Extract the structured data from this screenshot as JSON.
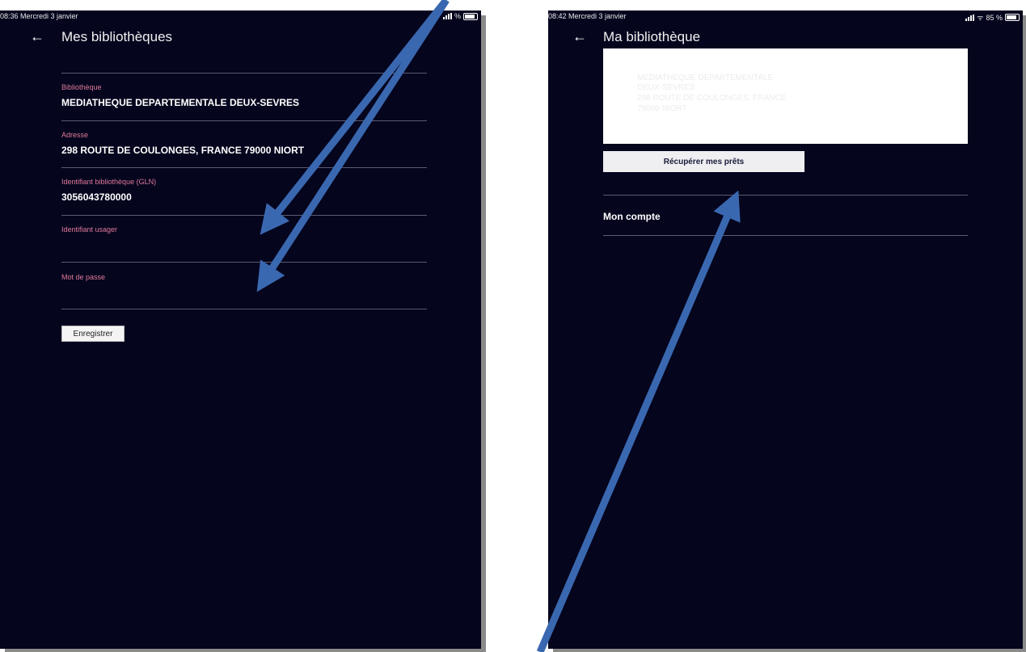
{
  "left": {
    "status_time": "08:36  Mercredi 3 janvier",
    "status_right": "% ",
    "title": "Mes bibliothèques",
    "fields": [
      {
        "label": "Bibliothèque",
        "value": "MEDIATHEQUE DEPARTEMENTALE DEUX-SEVRES"
      },
      {
        "label": "Adresse",
        "value": "298 ROUTE DE COULONGES, FRANCE 79000 NIORT"
      },
      {
        "label": "Identifiant bibliothèque (GLN)",
        "value": "3056043780000"
      },
      {
        "label": "Identifiant usager",
        "value": ""
      },
      {
        "label": "Mot de passe",
        "value": ""
      }
    ],
    "save_button": "Enregistrer"
  },
  "right": {
    "status_time": "08:42  Mercredi 3 janvier",
    "status_right": "85 %",
    "title": "Ma bibliothèque",
    "card_lines": [
      "MEDIATHEQUE DEPARTEMENTALE",
      "DEUX-SEVRES",
      "298 ROUTE DE COULONGES, FRANCE",
      "79000 NIORT"
    ],
    "fetch_button": "Récupérer mes prêts",
    "account_label": "Mon compte"
  },
  "colors": {
    "background": "#05051e",
    "label_pink": "#e07a9a",
    "divider": "#5a5a73",
    "annotation_arrow": "#3a68b0"
  },
  "icons": [
    "back-arrow-icon",
    "signal-icon",
    "wifi-icon",
    "battery-icon"
  ]
}
